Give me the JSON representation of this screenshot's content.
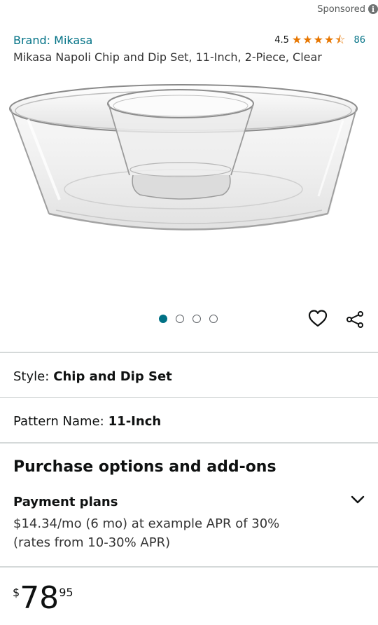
{
  "sponsored": {
    "label": "Sponsored",
    "info_glyph": "i"
  },
  "product": {
    "brand": "Brand: Mikasa",
    "title": "Mikasa Napoli Chip and Dip Set, 11-Inch, 2-Piece, Clear",
    "rating_value": "4.5",
    "rating_stars": 4.5,
    "rating_count": "86",
    "image_alt": "clear glass chip and dip bowl"
  },
  "gallery": {
    "image_count": 4,
    "active_index": 0
  },
  "style": {
    "label": "Style:",
    "value": "Chip and Dip Set"
  },
  "pattern": {
    "label": "Pattern Name:",
    "value": "11-Inch"
  },
  "purchase": {
    "heading": "Purchase options and add-ons",
    "payment_plans": {
      "heading": "Payment plans",
      "line1": "$14.34/mo (6 mo) at example APR of 30%",
      "line2": "(rates from 10-30% APR)"
    }
  },
  "price": {
    "symbol": "$",
    "whole": "78",
    "fraction": "95"
  },
  "colors": {
    "link": "#007185",
    "star": "#e77600",
    "text": "#0f1111",
    "divider": "#d5d9d9"
  },
  "icons": {
    "heart": "heart-icon",
    "share": "share-icon",
    "chevron": "chevron-down-icon",
    "info": "info-icon"
  }
}
